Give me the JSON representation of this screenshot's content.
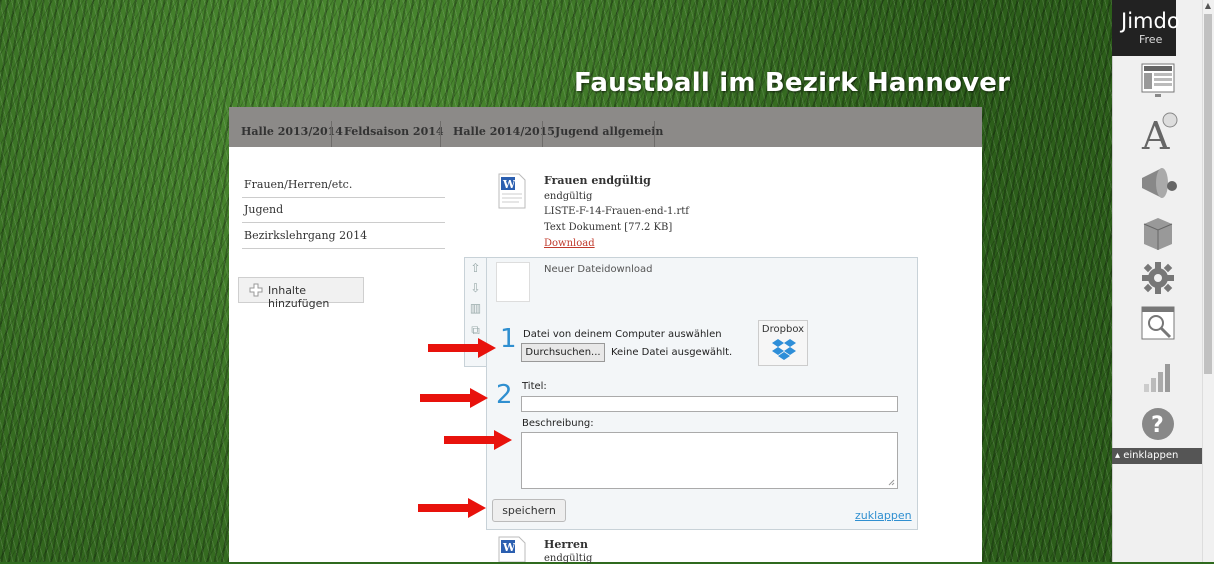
{
  "site": {
    "title": "Faustball im Bezirk Hannover"
  },
  "nav": {
    "items": [
      "Halle 2013/2014",
      "Feldsaison 2014",
      "Halle 2014/2015",
      "Jugend allgemein"
    ]
  },
  "sidenav": {
    "items": [
      "Frauen/Herren/etc.",
      "Jugend",
      "Bezirkslehrgang 2014"
    ]
  },
  "add_content": {
    "label": "Inhalte hinzufügen"
  },
  "file1": {
    "title": "Frauen endgültig",
    "description": "endgültig",
    "filename": "LISTE-F-14-Frauen-end-1.rtf",
    "meta": "Text Dokument [77.2 KB]",
    "download": "Download"
  },
  "editor": {
    "header": "Neuer Dateidownload",
    "step1_num": "1",
    "step1_label": "Datei von deinem Computer auswählen",
    "browse_label": "Durchsuchen...",
    "no_file": "Keine Datei ausgewählt.",
    "dropbox_label": "Dropbox",
    "step2_num": "2",
    "title_label": "Titel:",
    "desc_label": "Beschreibung:",
    "save_label": "speichern",
    "close_label": "zuklappen"
  },
  "file2": {
    "title": "Herren",
    "description": "endgültig"
  },
  "jimdo": {
    "name": "Jimdo",
    "tier": "Free",
    "collapse_label": "einklappen"
  },
  "colors": {
    "accent": "#2f8fd0",
    "link_red": "#c0392b",
    "nav_bg": "#8c8a88",
    "arrow": "#e8120c"
  }
}
